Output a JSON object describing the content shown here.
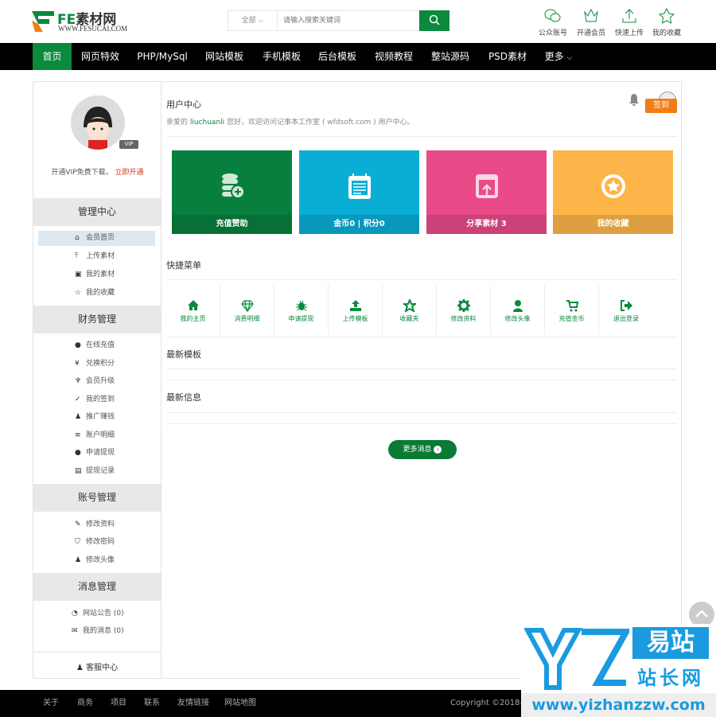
{
  "header": {
    "logo_brand": "FE",
    "logo_cn": "素材网",
    "logo_sub": "WWW.FESUCAI.COM",
    "search_category": "全部",
    "search_placeholder": "请输入搜索关键词",
    "icons": [
      {
        "label": "公众账号",
        "icon": "wechat-icon"
      },
      {
        "label": "开通会员",
        "icon": "crown-icon"
      },
      {
        "label": "快速上传",
        "icon": "upload-icon"
      },
      {
        "label": "我的收藏",
        "icon": "star-icon"
      }
    ]
  },
  "nav": {
    "items": [
      "首页",
      "网页特效",
      "PHP/MySql",
      "网站模板",
      "手机模板",
      "后台模板",
      "视频教程",
      "整站源码",
      "PSD素材",
      "更多"
    ],
    "active": "首页"
  },
  "sidebar": {
    "vip_badge": "VIP",
    "vip_text": "开通VIP免费下载，",
    "vip_link": "立即开通",
    "sections": [
      {
        "title": "管理中心",
        "items": [
          "会员首页",
          "上传素材",
          "我的素材",
          "我的收藏"
        ]
      },
      {
        "title": "财务管理",
        "items": [
          "在线充值",
          "兑换积分",
          "会员升级",
          "我的签到",
          "推广赚钱",
          "账户明细",
          "申请提现",
          "提现记录"
        ]
      },
      {
        "title": "账号管理",
        "items": [
          "修改资料",
          "修改密码",
          "修改头像"
        ]
      },
      {
        "title": "消息管理",
        "items": [
          "网站公告 (0)",
          "我的消息 (0)"
        ]
      }
    ],
    "kefu": "客服中心"
  },
  "main": {
    "title": "用户中心",
    "greet_pre": "亲爱的 ",
    "username": "liuchuanli",
    "greet_post": " 您好，欢迎访问记事本工作室 ( wfdsoft.com ) 用户中心。",
    "sign_label": "签到",
    "cards": [
      {
        "label": "充值赞助",
        "color": "#07803e"
      },
      {
        "label": "金币0 | 积分0",
        "color": "#0aaed5"
      },
      {
        "label": "分享素材 3",
        "color": "#e94a88"
      },
      {
        "label": "我的收藏",
        "color": "#fdb549"
      }
    ],
    "quick_title": "快捷菜单",
    "quick": [
      {
        "label": "我的主页",
        "icon": "home-icon"
      },
      {
        "label": "消费明细",
        "icon": "diamond-icon"
      },
      {
        "label": "申请提现",
        "icon": "bug-icon"
      },
      {
        "label": "上传模板",
        "icon": "upload-icon"
      },
      {
        "label": "收藏夹",
        "icon": "star-icon"
      },
      {
        "label": "修改资料",
        "icon": "gear-icon"
      },
      {
        "label": "修改头像",
        "icon": "user-icon"
      },
      {
        "label": "充值金币",
        "icon": "cart-icon"
      },
      {
        "label": "退出登录",
        "icon": "logout-icon"
      }
    ],
    "latest_templates": "最新模板",
    "latest_news": "最新信息",
    "more_label": "更多消息"
  },
  "footer": {
    "links": [
      "关于",
      "商务",
      "项目",
      "联系",
      "友情链接",
      "网站地图"
    ],
    "copyright": "Copyright ©2018-2"
  },
  "watermark": {
    "cn1": "易站",
    "cn2": "站长网",
    "url": "www.yizhanzzw.com"
  },
  "colors": {
    "brand": "#0a8a3c",
    "sign": "#f07d17",
    "link": "#d9341c"
  }
}
